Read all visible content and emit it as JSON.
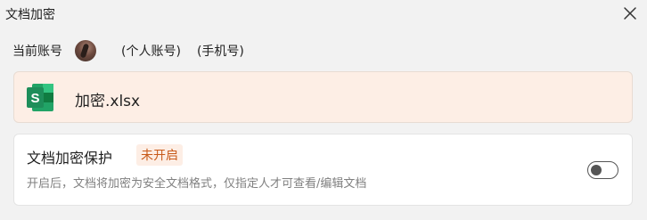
{
  "window": {
    "title": "文档加密",
    "close_icon": "close-icon"
  },
  "account": {
    "label": "当前账号",
    "account_type": "(个人账号)",
    "login_method": "(手机号)"
  },
  "file": {
    "icon": "spreadsheet-icon",
    "icon_letter": "S",
    "icon_color": "#1e8e5a",
    "name": "加密.xlsx"
  },
  "protection": {
    "title": "文档加密保护",
    "status": "未开启",
    "status_color": "#c85a1a",
    "description": "开启后，文档将加密为安全文档格式，仅指定人才可查看/编辑文档",
    "enabled": false
  }
}
